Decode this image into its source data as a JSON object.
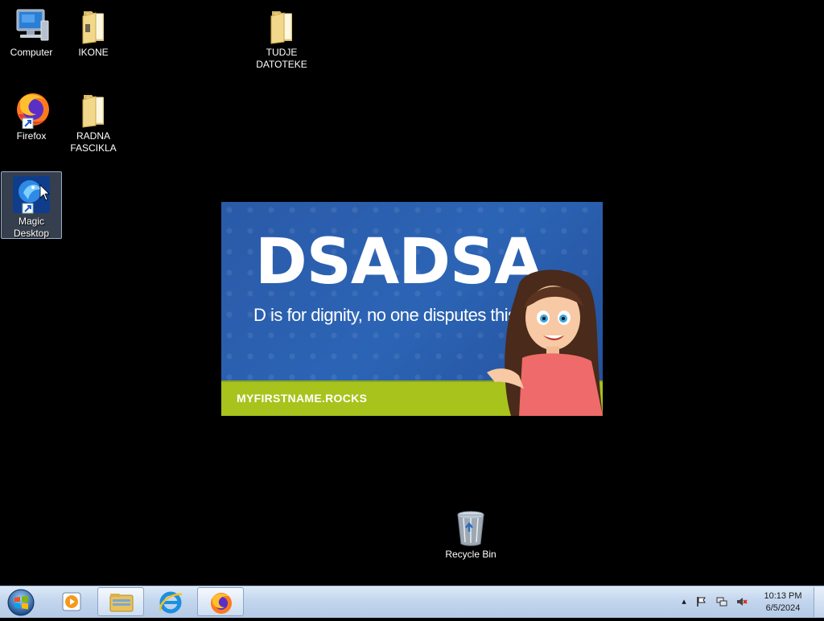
{
  "desktop": {
    "icons": [
      {
        "label": "Computer",
        "icon": "computer-icon"
      },
      {
        "label": "IKONE",
        "icon": "folder-icon"
      },
      {
        "label": "TUDJE\nDATOTEKE",
        "icon": "folder-icon"
      },
      {
        "label": "Firefox",
        "icon": "firefox-icon"
      },
      {
        "label": "RADNA\nFASCIKLA",
        "icon": "folder-icon"
      },
      {
        "label": "Magic\nDesktop",
        "icon": "magic-desktop-icon"
      },
      {
        "label": "Recycle Bin",
        "icon": "recycle-bin-icon"
      }
    ]
  },
  "wallpaper": {
    "title": "DSADSA",
    "subtitle": "D is for dignity, no one disputes this trait!",
    "site": "MYFIRSTNAME.ROCKS",
    "colors": {
      "background": "#2c64b5",
      "bar": "#a8c31c"
    }
  },
  "taskbar": {
    "start": "windows-start-icon",
    "buttons": [
      {
        "icon": "media-player-icon"
      },
      {
        "icon": "file-explorer-icon"
      },
      {
        "icon": "internet-explorer-icon"
      },
      {
        "icon": "firefox-icon"
      }
    ],
    "tray": {
      "icons": [
        "show-hidden-icons-arrow",
        "action-center-flag-icon",
        "network-icon",
        "volume-muted-icon"
      ]
    },
    "clock": {
      "time": "10:13 PM",
      "date": "6/5/2024"
    }
  }
}
